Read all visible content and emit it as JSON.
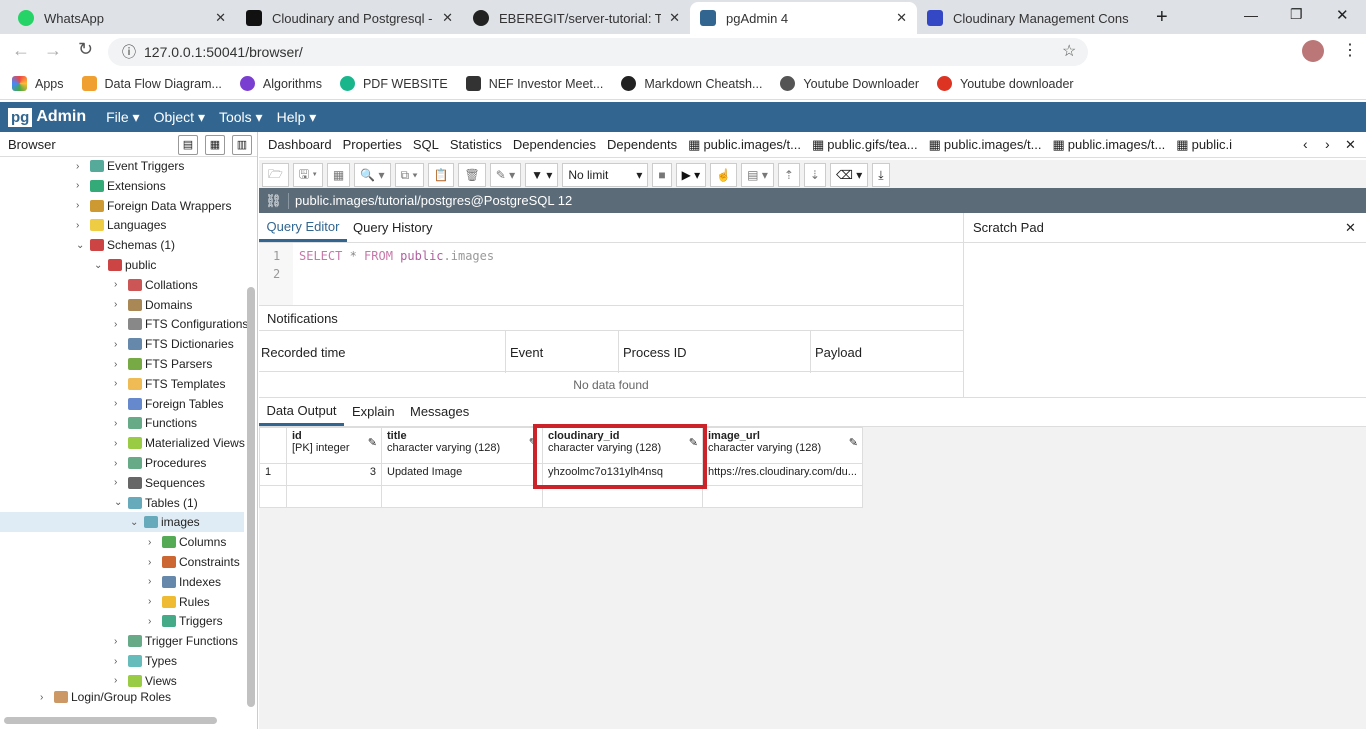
{
  "browser_tabs": [
    {
      "label": "WhatsApp",
      "color": "#25d366"
    },
    {
      "label": "Cloudinary and Postgresql - De",
      "color": "#111111"
    },
    {
      "label": "EBEREGIT/server-tutorial: This",
      "color": "#222222"
    },
    {
      "label": "pgAdmin 4",
      "color": "#326690"
    },
    {
      "label": "Cloudinary Management Cons",
      "color": "#3448c5"
    }
  ],
  "url": "127.0.0.1:50041/browser/",
  "bookmarks": [
    {
      "label": "Apps",
      "color": "#e44"
    },
    {
      "label": "Data Flow Diagram...",
      "color": "#f0a030"
    },
    {
      "label": "Algorithms",
      "color": "#7a3fd0"
    },
    {
      "label": "PDF WEBSITE",
      "color": "#19b68c"
    },
    {
      "label": "NEF Investor Meet...",
      "color": "#333"
    },
    {
      "label": "Markdown Cheatsh...",
      "color": "#222"
    },
    {
      "label": "Youtube Downloader",
      "color": "#555"
    },
    {
      "label": "Youtube downloader",
      "color": "#d32"
    }
  ],
  "app": {
    "logo_a": "pg",
    "logo_b": "Admin",
    "menus": [
      "File",
      "Object",
      "Tools",
      "Help"
    ]
  },
  "browser_panel": {
    "title": "Browser",
    "tree": [
      {
        "label": "Event Triggers",
        "level": 2,
        "color": "#5a9"
      },
      {
        "label": "Extensions",
        "level": 2,
        "color": "#3a7"
      },
      {
        "label": "Foreign Data Wrappers",
        "level": 2,
        "color": "#c93"
      },
      {
        "label": "Languages",
        "level": 2,
        "color": "#ec4"
      },
      {
        "label": "Schemas (1)",
        "level": 2,
        "color": "#c44",
        "open": true
      },
      {
        "label": "public",
        "level": 3,
        "color": "#c44",
        "open": true
      },
      {
        "label": "Collations",
        "level": 4,
        "color": "#c55"
      },
      {
        "label": "Domains",
        "level": 4,
        "color": "#a85"
      },
      {
        "label": "FTS Configurations",
        "level": 4,
        "color": "#888"
      },
      {
        "label": "FTS Dictionaries",
        "level": 4,
        "color": "#68a"
      },
      {
        "label": "FTS Parsers",
        "level": 4,
        "color": "#7a4"
      },
      {
        "label": "FTS Templates",
        "level": 4,
        "color": "#eb5"
      },
      {
        "label": "Foreign Tables",
        "level": 4,
        "color": "#68c"
      },
      {
        "label": "Functions",
        "level": 4,
        "color": "#6a8"
      },
      {
        "label": "Materialized Views",
        "level": 4,
        "color": "#9c4"
      },
      {
        "label": "Procedures",
        "level": 4,
        "color": "#6a8"
      },
      {
        "label": "Sequences",
        "level": 4,
        "color": "#666"
      },
      {
        "label": "Tables (1)",
        "level": 4,
        "color": "#6ab",
        "open": true
      },
      {
        "label": "images",
        "level": 5,
        "color": "#6ab",
        "open": true,
        "selected": true
      },
      {
        "label": "Columns",
        "level": 6,
        "color": "#5a5"
      },
      {
        "label": "Constraints",
        "level": 6,
        "color": "#c63"
      },
      {
        "label": "Indexes",
        "level": 6,
        "color": "#68a"
      },
      {
        "label": "Rules",
        "level": 6,
        "color": "#eb3"
      },
      {
        "label": "Triggers",
        "level": 6,
        "color": "#4a8"
      },
      {
        "label": "Trigger Functions",
        "level": 4,
        "color": "#6a8"
      },
      {
        "label": "Types",
        "level": 4,
        "color": "#6bb"
      },
      {
        "label": "Views",
        "level": 4,
        "color": "#9c4"
      },
      {
        "label": "Login/Group Roles",
        "level": 1,
        "color": "#c96"
      }
    ]
  },
  "panel_tabs": [
    "Dashboard",
    "Properties",
    "SQL",
    "Statistics",
    "Dependencies",
    "Dependents",
    "public.images/t...",
    "public.gifs/tea...",
    "public.images/t...",
    "public.images/t...",
    "public.i"
  ],
  "toolbar": {
    "limit": "No limit"
  },
  "connection": "public.images/tutorial/postgres@PostgreSQL 12",
  "editor_tabs": [
    "Query Editor",
    "Query History"
  ],
  "scratch_pad": "Scratch Pad",
  "editor_lines": [
    {
      "n": "1",
      "kw1": "SELECT",
      "op": " * ",
      "kw2": "FROM",
      "schema": " public",
      "rest": ".images"
    },
    {
      "n": "2"
    }
  ],
  "notifications": {
    "title": "Notifications",
    "columns": [
      "Recorded time",
      "Event",
      "Process ID",
      "Payload"
    ],
    "empty": "No data found"
  },
  "output_tabs": [
    "Data Output",
    "Explain",
    "Messages"
  ],
  "grid": {
    "columns": [
      {
        "name": "id",
        "type": "[PK] integer"
      },
      {
        "name": "title",
        "type": "character varying (128)"
      },
      {
        "name": "cloudinary_id",
        "type": "character varying (128)"
      },
      {
        "name": "image_url",
        "type": "character varying (128)"
      }
    ],
    "rows": [
      {
        "n": "1",
        "id": "3",
        "title": "Updated Image",
        "cloudinary_id": "yhzoolmc7o131ylh4nsq",
        "image_url": "https://res.cloudinary.com/du..."
      }
    ]
  },
  "highlight_color": "#cc2229"
}
